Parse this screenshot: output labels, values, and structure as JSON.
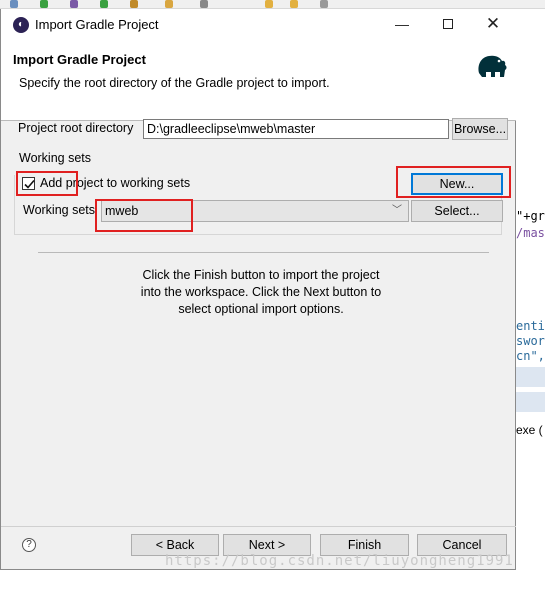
{
  "window": {
    "title": "Import Gradle Project"
  },
  "header": {
    "title": "Import Gradle Project",
    "description": "Specify the root directory of the Gradle project to import."
  },
  "root_directory": {
    "label": "Project root directory",
    "value": "D:\\gradleeclipse\\mweb\\master",
    "browse_label": "Browse..."
  },
  "working_sets": {
    "group_label": "Working sets",
    "checkbox_label": "Add project to working sets",
    "checked": true,
    "new_label": "New...",
    "field_label": "Working sets",
    "selected": "mweb",
    "select_label": "Select..."
  },
  "info": {
    "line1": "Click the Finish button to import the project",
    "line2": "into the workspace. Click the Next button to",
    "line3": "select optional import options."
  },
  "footer": {
    "back_label": "< Back",
    "next_label": "Next >",
    "finish_label": "Finish",
    "cancel_label": "Cancel"
  },
  "background_editor": {
    "line1": "\"+gr",
    "line2": "/mas",
    "line3": "enti",
    "line4": "swor",
    "line5": "cn\",",
    "console_text": "exe ("
  },
  "watermark": "https://blog.csdn.net/liuyongheng1991",
  "colors": {
    "accent": "#0078d7",
    "annotation_red": "#e02020"
  }
}
